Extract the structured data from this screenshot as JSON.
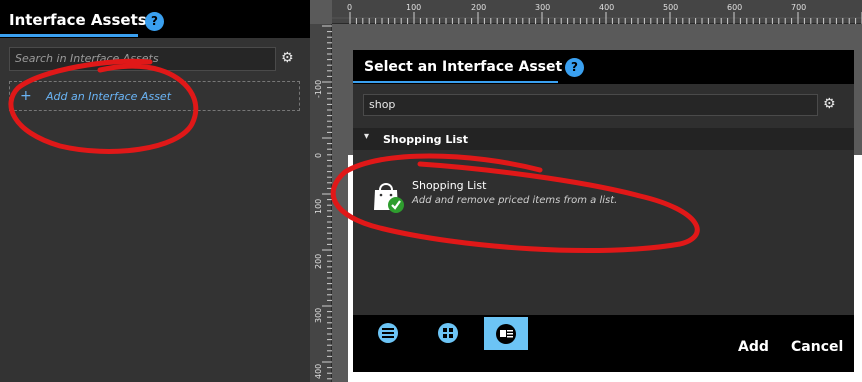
{
  "left_panel": {
    "title": "Interface Assets",
    "help_label": "?",
    "search_placeholder": "Search in Interface Assets",
    "add_label": "Add an Interface Asset",
    "add_plus": "+"
  },
  "ruler": {
    "top_ticks": [
      "0",
      "100",
      "200",
      "300",
      "400",
      "500",
      "600",
      "700"
    ],
    "left_ticks": [
      "-100",
      "0",
      "100",
      "200",
      "300",
      "400"
    ]
  },
  "dialog": {
    "title": "Select an Interface Asset",
    "help_label": "?",
    "search_value": "shop",
    "category": "Shopping List",
    "asset": {
      "name": "Shopping List",
      "description": "Add and remove priced items from a list."
    },
    "view_modes": [
      "list-view-icon",
      "grid-view-icon",
      "card-view-icon"
    ],
    "active_view": "card-view-icon",
    "add_label": "Add",
    "cancel_label": "Cancel"
  },
  "colors": {
    "accent": "#3aa0f0",
    "annotation": "#e01818"
  }
}
